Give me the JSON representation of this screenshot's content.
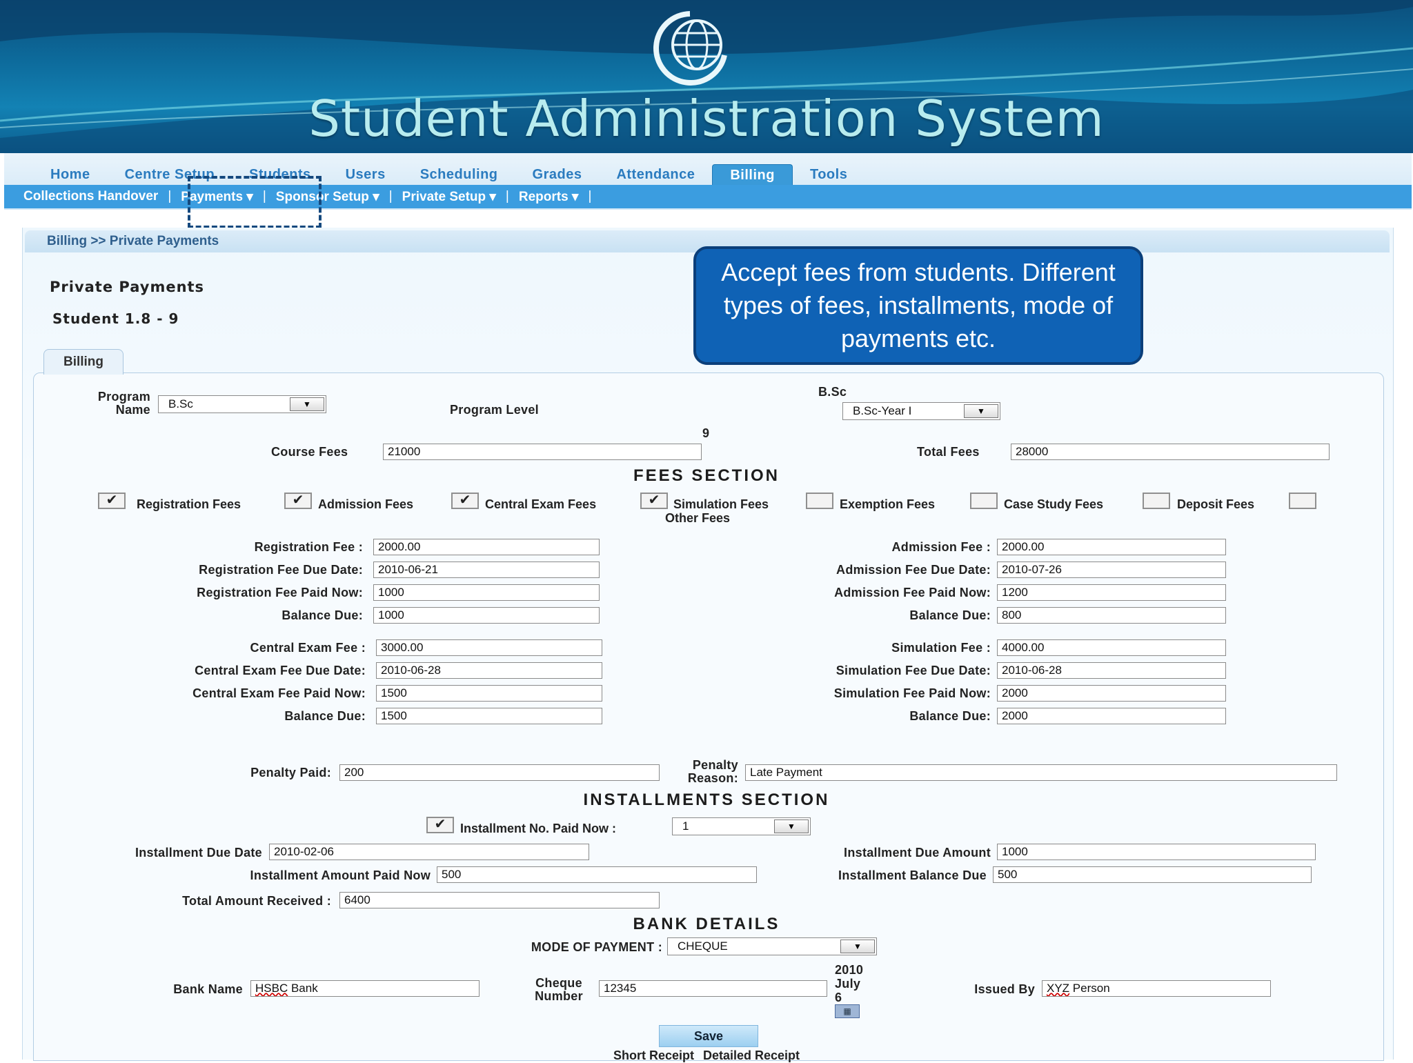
{
  "app": {
    "title": "Student Administration System"
  },
  "nav": {
    "main_tabs": [
      {
        "label": "Home"
      },
      {
        "label": "Centre Setup"
      },
      {
        "label": "Students"
      },
      {
        "label": "Users"
      },
      {
        "label": "Scheduling"
      },
      {
        "label": "Grades"
      },
      {
        "label": "Attendance"
      },
      {
        "label": "Billing"
      },
      {
        "label": "Tools"
      }
    ],
    "active_tab": "Billing",
    "sub_items": [
      {
        "label": "Collections Handover"
      },
      {
        "label": "Payments ▾"
      },
      {
        "label": "Sponsor Setup ▾"
      },
      {
        "label": "Private Setup ▾"
      },
      {
        "label": "Reports ▾"
      }
    ],
    "separator": "|"
  },
  "breadcrumb": "Billing >> Private Payments",
  "page": {
    "title": "Private Payments",
    "student": "Student 1.8 - 9"
  },
  "callout": {
    "text": "Accept fees from students. Different types of fees, installments, mode of payments etc."
  },
  "form_tab": "Billing",
  "program": {
    "name_label": "Program Name",
    "name_value": "B.Sc",
    "level_label": "Program Level",
    "level_heading": "B.Sc",
    "level_value": "B.Sc-Year I",
    "number_marker": "9",
    "course_fees_label": "Course Fees",
    "course_fees_value": "21000",
    "total_fees_label": "Total Fees",
    "total_fees_value": "28000"
  },
  "fees_section": {
    "heading": "FEES SECTION",
    "checkboxes": [
      {
        "label": "Registration Fees",
        "checked": true
      },
      {
        "label": "Admission Fees",
        "checked": true
      },
      {
        "label": "Central Exam Fees",
        "checked": true
      },
      {
        "label": "Simulation Fees",
        "checked": true
      },
      {
        "label": "Exemption Fees",
        "checked": false
      },
      {
        "label": "Case Study Fees",
        "checked": false
      },
      {
        "label": "Deposit Fees",
        "checked": false
      },
      {
        "label": "Other Fees",
        "checked": false
      }
    ],
    "check_mark": "✔",
    "registration": {
      "fee_label": "Registration Fee :",
      "fee": "2000.00",
      "due_label": "Registration Fee Due Date:",
      "due": "2010-06-21",
      "paid_label": "Registration Fee Paid Now:",
      "paid": "1000",
      "balance_label": "Balance Due:",
      "balance": "1000"
    },
    "admission": {
      "fee_label": "Admission Fee :",
      "fee": "2000.00",
      "due_label": "Admission Fee Due Date:",
      "due": "2010-07-26",
      "paid_label": "Admission Fee Paid Now:",
      "paid": "1200",
      "balance_label": "Balance Due:",
      "balance": "800"
    },
    "central_exam": {
      "fee_label": "Central Exam Fee :",
      "fee": "3000.00",
      "due_label": "Central Exam Fee Due Date:",
      "due": "2010-06-28",
      "paid_label": "Central Exam Fee Paid Now:",
      "paid": "1500",
      "balance_label": "Balance Due:",
      "balance": "1500"
    },
    "simulation": {
      "fee_label": "Simulation Fee :",
      "fee": "4000.00",
      "due_label": "Simulation Fee Due Date:",
      "due": "2010-06-28",
      "paid_label": "Simulation Fee Paid Now:",
      "paid": "2000",
      "balance_label": "Balance Due:",
      "balance": "2000"
    },
    "penalty_paid_label": "Penalty Paid:",
    "penalty_paid": "200",
    "penalty_reason_label": "Penalty Reason:",
    "penalty_reason": "Late Payment"
  },
  "installments": {
    "heading": "INSTALLMENTS SECTION",
    "no_paid_label": "Installment No. Paid Now :",
    "no_paid_checked": true,
    "no_paid_value": "1",
    "due_date_label": "Installment Due Date",
    "due_date": "2010-02-06",
    "due_amount_label": "Installment Due Amount",
    "due_amount": "1000",
    "amount_paid_label": "Installment Amount Paid Now",
    "amount_paid": "500",
    "balance_label": "Installment Balance Due",
    "balance": "500",
    "total_received_label": "Total Amount Received :",
    "total_received": "6400"
  },
  "bank": {
    "heading": "BANK DETAILS",
    "mode_label": "MODE OF PAYMENT :",
    "mode_value": "CHEQUE",
    "bank_name_label": "Bank Name",
    "bank_name_brand": "HSBC",
    "bank_name_rest": " Bank",
    "cheque_label": "Cheque Number",
    "cheque_value": "12345",
    "date_year": "2010",
    "date_month": "July",
    "date_day": "6",
    "issued_by_label": "Issued By",
    "issued_by_brand": "XYZ",
    "issued_by_rest": " Person"
  },
  "actions": {
    "save": "Save",
    "short_receipt": "Short Receipt",
    "detailed_receipt": "Detailed Receipt"
  },
  "colors": {
    "accent": "#3b9de0",
    "callout": "#0f62b5",
    "banner": "#0d6b9c"
  }
}
